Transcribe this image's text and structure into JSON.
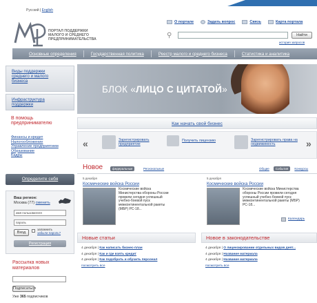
{
  "lang": {
    "current": "Русский",
    "sep": "|",
    "other": "English"
  },
  "logo": {
    "mark": "МСП",
    "line1": "ПОРТАЛ ПОДДЕРЖКИ",
    "line2": "МАЛОГО И СРЕДНЕГО",
    "line3": "ПРЕДПРИНИМАТЕЛЬСТВА"
  },
  "top_links": [
    {
      "label": "О портале"
    },
    {
      "label": "Задать вопрос"
    },
    {
      "label": "Связь"
    },
    {
      "label": "Карта портала"
    }
  ],
  "search": {
    "value": "",
    "button": "Найти",
    "history": "история запросов"
  },
  "nav": [
    "Основные определения",
    "Государственная политика",
    "Реестр малого и среднего бизнеса",
    "Статистика и аналитика"
  ],
  "sidebar": {
    "box1": [
      "Виды поддержки среднего и малого бизнеса"
    ],
    "box2": [
      "Инфраструктура поддержки"
    ],
    "help_title": "В помощь предпринимателю",
    "help_links": [
      "Финансы и кредит",
      "Налогообложение",
      "Управление предприятием",
      "Образование",
      "Кадры"
    ],
    "define_btn": "Определите себя",
    "region_label": "Ваш регион:",
    "region_value": "Москва (77)",
    "region_change": "сменить",
    "username_value": "имя пользователя",
    "password_value": "пароль",
    "login_btn": "Вход",
    "remember": "запомнить",
    "forgot": "забыли пароль?",
    "register_btn": "Регистрация",
    "subscribe_title": "Рассылка новых материалов",
    "subscribe_btn": "Подписаться",
    "subscribers_prefix": "Уже",
    "subscribers_count": "365",
    "subscribers_suffix": "подписчиков"
  },
  "banner": {
    "text_pre": "БЛОК «",
    "text_bold": "ЛИЦО С ЦИТАТОЙ",
    "text_post": "»"
  },
  "start_link": "Как начать свой бизнес",
  "reg_items": [
    "Зарегистрировать предприятие",
    "Получить лицензию",
    "Зарегистрировать права на недвижимость"
  ],
  "news": {
    "title": "Новое",
    "tag_federal": "федеральные",
    "tag_regional": "Региональные",
    "right_tags": [
      "Общие",
      "События",
      "Конкурсы"
    ],
    "items": [
      {
        "date": "5 декабря",
        "head": "Космические войска России",
        "body": "Космические войска Министерства обороны России провели сегодня успешный учебно-боевой пуск межконтинентальной ракеты (МБР) РС-18..."
      },
      {
        "date": "5 декабря",
        "head": "Космические войска России",
        "body": "Космические войска Министерства обороны России провели сегодня успешный учебно-боевой пуск межконтинентальной ракеты (МБР) РС-18..."
      }
    ],
    "calendar": "Календарь"
  },
  "articles": {
    "title": "Новые статьи",
    "items": [
      {
        "date": "4 декабря",
        "sep": "|",
        "link": "Как написать бизнес-план"
      },
      {
        "date": "4 декабря",
        "sep": "|",
        "link": "Как и где взять кредит"
      },
      {
        "date": "4 декабря",
        "sep": "|",
        "link": "Как подобрать и обучить персонал"
      }
    ],
    "see_all": "посмотреть все"
  },
  "law": {
    "title": "Новое в законодательстве",
    "items": [
      {
        "date": "4 декабря",
        "sep": "|",
        "link": "О лицензировании отдельных видов деят..."
      },
      {
        "date": "4 декабря",
        "sep": "|",
        "link": "Название материала"
      },
      {
        "date": "4 декабря",
        "sep": "|",
        "link": "Название материала"
      }
    ],
    "see_all": "посмотреть все"
  },
  "colors": {
    "accent_red": "#c0272d",
    "link_blue": "#1f4fa0",
    "nav_gray": "#8a95a3"
  }
}
